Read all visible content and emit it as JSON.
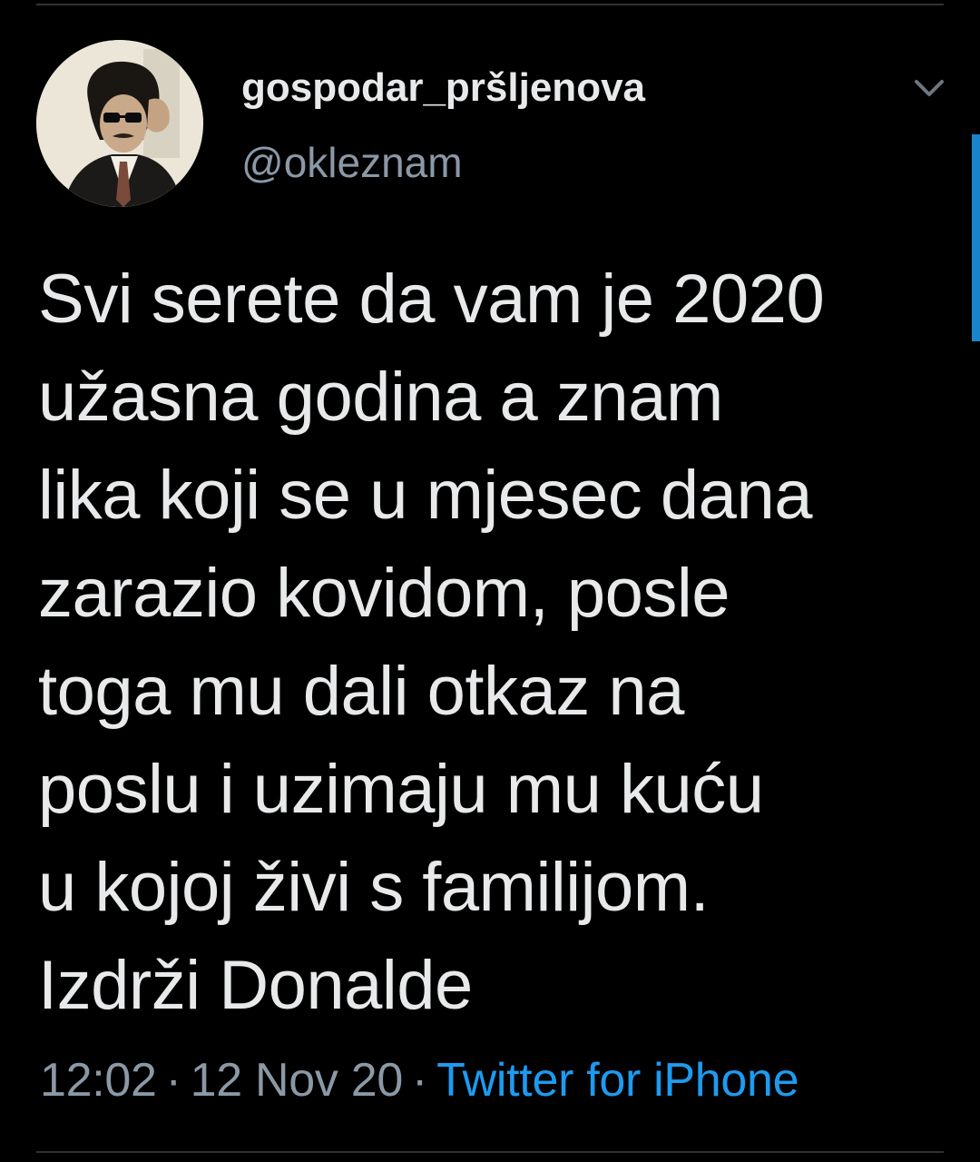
{
  "colors": {
    "background": "#000000",
    "text_primary": "#e7e9ea",
    "text_secondary": "#8b98a5",
    "accent": "#1d9bf0"
  },
  "author": {
    "display_name": "gospodar_pršljenova",
    "handle": "@okleznam",
    "avatar_icon": "profile-photo"
  },
  "tweet": {
    "text_lines": [
      "Svi serete da vam je 2020",
      "užasna godina a znam",
      "lika koji se u mjesec dana",
      "zarazio kovidom, posle",
      "toga mu dali otkaz na",
      "poslu i uzimaju mu kuću",
      "u kojoj živi s familijom.",
      "Izdrži Donalde"
    ],
    "time": "12:02",
    "date": "12 Nov 20",
    "separator": "·",
    "source": "Twitter for iPhone"
  },
  "icons": {
    "menu": "chevron-down-icon"
  }
}
